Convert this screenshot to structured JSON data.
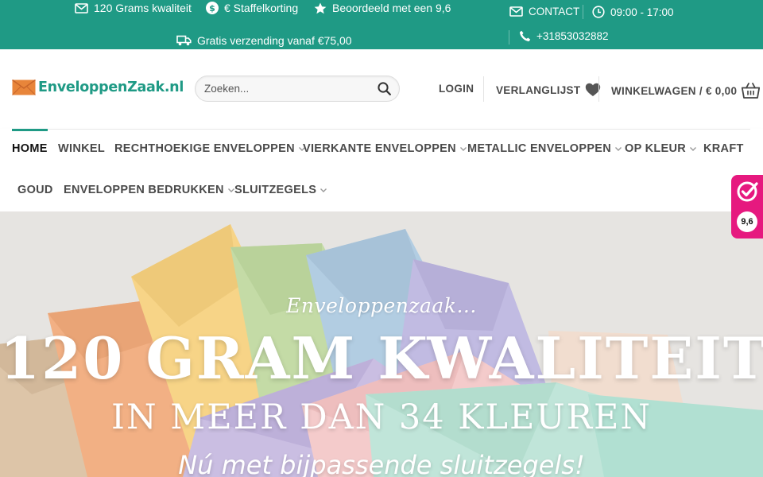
{
  "topbar": {
    "usp1": "120 Grams kwaliteit",
    "usp2": "€ Staffelkorting",
    "usp3": "Beoordeeld met een 9,6",
    "usp4": "Gratis verzending vanaf €75,00",
    "contact": "CONTACT",
    "hours": "09:00 - 17:00",
    "phone": "+31853032882",
    "color": "#1f9a85"
  },
  "header": {
    "logo_text": "EnveloppenZaak.nl",
    "search_placeholder": "Zoeken...",
    "login": "LOGIN",
    "wishlist": "VERLANGLIJST",
    "cart": "WINKELWAGEN / € 0,00"
  },
  "nav": {
    "items": [
      {
        "label": "HOME"
      },
      {
        "label": "WINKEL"
      },
      {
        "label": "RECHTHOEKIGE ENVELOPPEN"
      },
      {
        "label": "VIERKANTE ENVELOPPEN"
      },
      {
        "label": "METALLIC ENVELOPPEN"
      },
      {
        "label": "OP KLEUR"
      },
      {
        "label": "KRAFT"
      },
      {
        "label": "GOUD"
      },
      {
        "label": "ENVELOPPEN BEDRUKKEN"
      },
      {
        "label": "SLUITZEGELS"
      }
    ]
  },
  "badge": {
    "score": "9,6",
    "color": "#e6197f",
    "icon": "kiyoh-check-icon"
  },
  "hero": {
    "script": "Enveloppenzaak...",
    "title": "120 GRAM KWALITEIT",
    "subtitle": "IN MEER DAN 34 KLEUREN",
    "tagline": "Nú met bijpassende sluitzegels!"
  }
}
